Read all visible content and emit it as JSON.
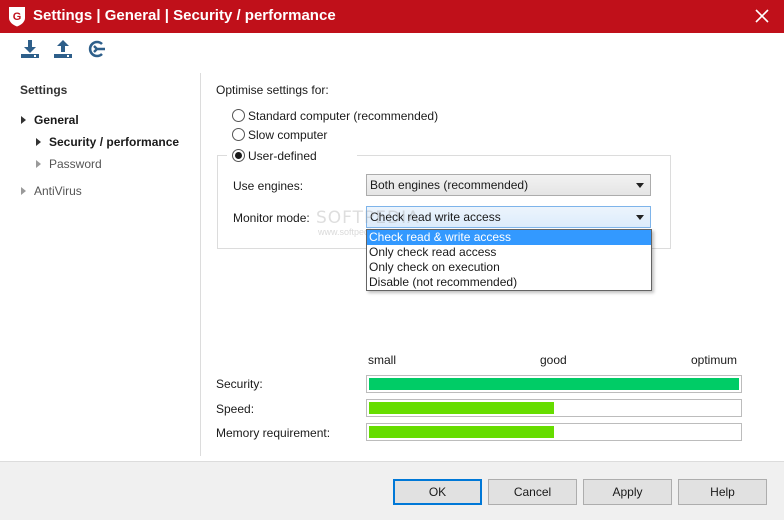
{
  "window": {
    "title": "Settings | General | Security / performance",
    "accent_color": "#c0101a"
  },
  "toolbar": {
    "buttons": [
      {
        "icon": "download-icon",
        "name": "import"
      },
      {
        "icon": "upload-icon",
        "name": "export"
      },
      {
        "icon": "reset-icon",
        "name": "restore-defaults"
      }
    ]
  },
  "sidebar": {
    "heading": "Settings",
    "items": [
      {
        "label": "General",
        "level": 1,
        "expanded": true
      },
      {
        "label": "Security / performance",
        "level": 2,
        "selected": true
      },
      {
        "label": "Password",
        "level": 2
      },
      {
        "label": "AntiVirus",
        "level": 1,
        "expanded": false
      }
    ]
  },
  "main": {
    "optimise_label": "Optimise settings for:",
    "options": [
      {
        "label": "Standard computer (recommended)",
        "checked": false
      },
      {
        "label": "Slow computer",
        "checked": false
      },
      {
        "label": "User-defined",
        "checked": true
      }
    ],
    "engines_label": "Use engines:",
    "engines_value": "Both engines (recommended)",
    "monitor_label": "Monitor mode:",
    "monitor_value": "Check read  write access",
    "monitor_options": [
      {
        "label": "Check read & write access",
        "selected": true
      },
      {
        "label": "Only check read access",
        "selected": false
      },
      {
        "label": "Only check on execution",
        "selected": false
      },
      {
        "label": "Disable (not recommended)",
        "selected": false
      }
    ],
    "watermark": "SOFTPEDIA",
    "watermark_sub": "www.softpedia.com",
    "scale": {
      "low": "small",
      "mid": "good",
      "high": "optimum"
    },
    "meters": [
      {
        "label": "Security:",
        "level": 1.0,
        "color": "#00cc66"
      },
      {
        "label": "Speed:",
        "level": 0.5,
        "color": "#66dd00"
      },
      {
        "label": "Memory requirement:",
        "level": 0.5,
        "color": "#66dd00"
      }
    ]
  },
  "footer": {
    "ok": "OK",
    "cancel": "Cancel",
    "apply": "Apply",
    "help": "Help"
  }
}
